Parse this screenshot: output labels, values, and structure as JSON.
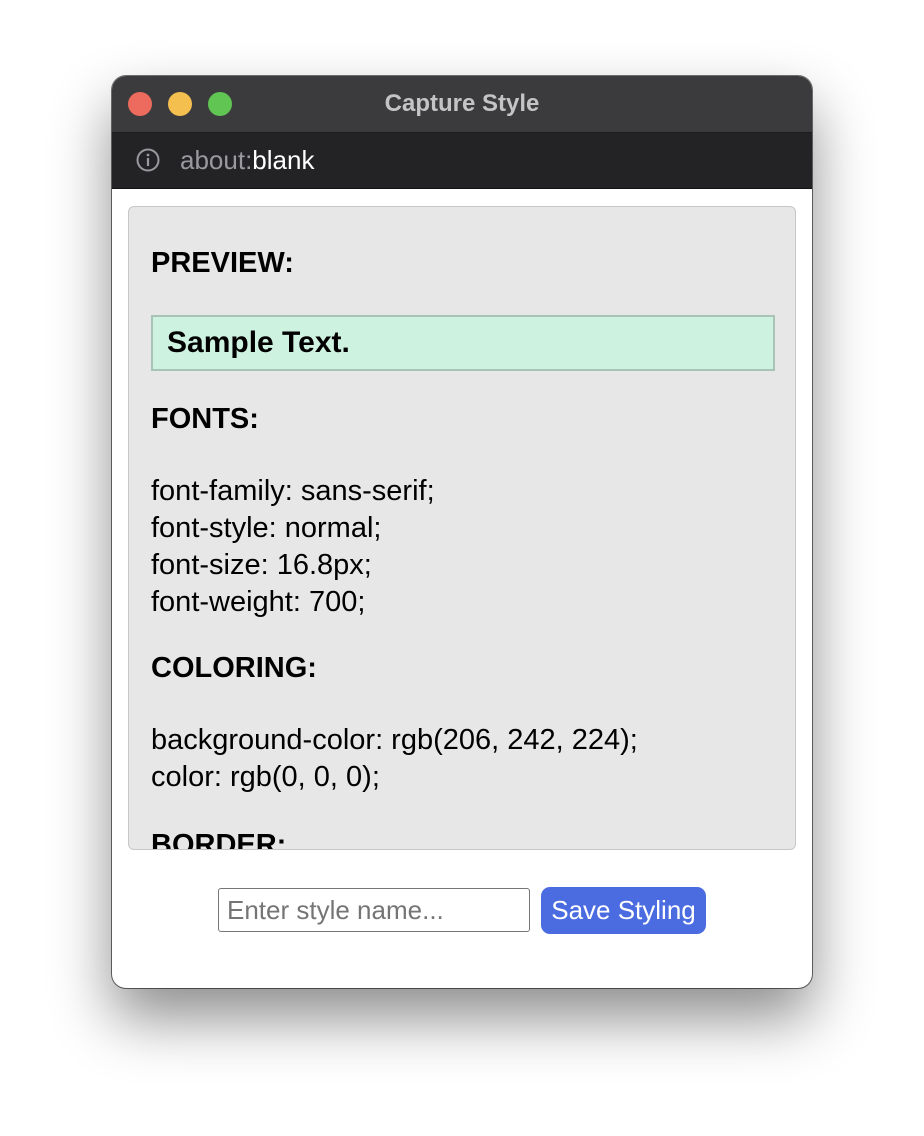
{
  "window": {
    "title": "Capture Style"
  },
  "urlbar": {
    "icon": "info-icon",
    "scheme": "about:",
    "path": "blank"
  },
  "panel": {
    "preview_heading": "PREVIEW:",
    "sample_text": "Sample Text.",
    "fonts_heading": "FONTS:",
    "fonts": [
      "font-family: sans-serif;",
      "font-style: normal;",
      "font-size: 16.8px;",
      "font-weight: 700;"
    ],
    "coloring_heading": "COLORING:",
    "coloring": [
      "background-color: rgb(206, 242, 224);",
      "color: rgb(0, 0, 0);"
    ],
    "border_heading": "BORDER:"
  },
  "footer": {
    "input_placeholder": "Enter style name...",
    "input_value": "",
    "save_label": "Save Styling"
  },
  "colors": {
    "accent": "#4a6ce0",
    "sample_bg": "#cef2e0",
    "titlebar": "#3b3b3d"
  }
}
